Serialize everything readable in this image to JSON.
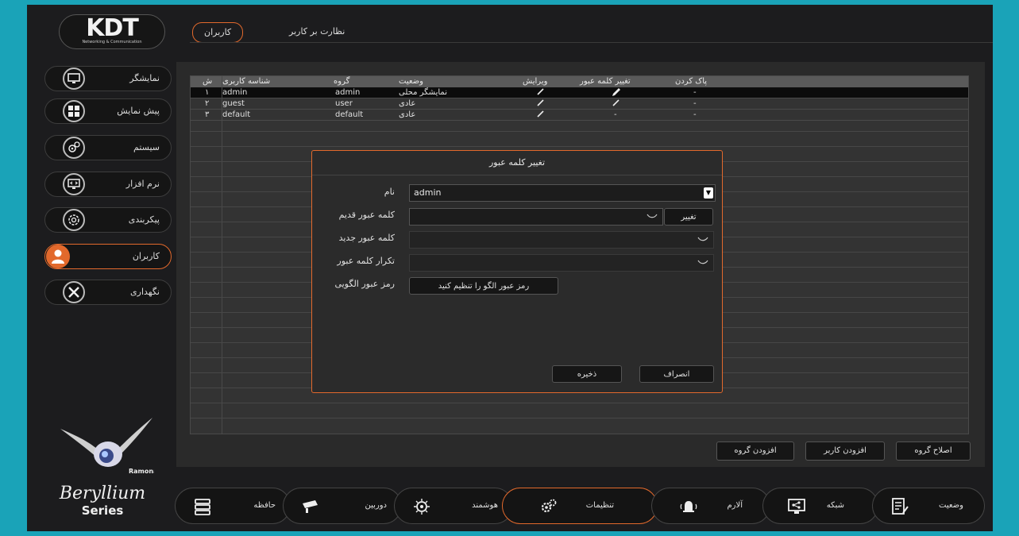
{
  "logo": {
    "text": "KDT",
    "subtitle": "Networking & Communication"
  },
  "top_tabs": [
    {
      "label": "کاربران",
      "active": true
    },
    {
      "label": "نظارت بر کاربر",
      "active": false
    }
  ],
  "sidebar": {
    "items": [
      {
        "label": "نمایشگر",
        "icon": "monitor-icon"
      },
      {
        "label": "پیش نمایش",
        "icon": "grid-icon"
      },
      {
        "label": "سیستم",
        "icon": "gears-icon"
      },
      {
        "label": "نرم افزار",
        "icon": "code-monitor-icon"
      },
      {
        "label": "پیکربندی",
        "icon": "config-gear-icon"
      },
      {
        "label": "کاربران",
        "icon": "user-icon",
        "active": true
      },
      {
        "label": "نگهداری",
        "icon": "tools-icon"
      }
    ]
  },
  "table": {
    "headers": {
      "num": "ش",
      "user_id": "شناسه کاربری",
      "group": "گروه",
      "status": "وضعیت",
      "edit": "ویرایش",
      "change_pw": "تغییر کلمه عبور",
      "clear": "پاک کردن"
    },
    "rows": [
      {
        "num": "۱",
        "user_id": "admin",
        "group": "admin",
        "status": "نمایشگر محلی",
        "clear": "-"
      },
      {
        "num": "۲",
        "user_id": "guest",
        "group": "user",
        "status": "عادی",
        "change_pw": "-",
        "clear": "-"
      },
      {
        "num": "۳",
        "user_id": "default",
        "group": "default",
        "status": "عادی",
        "change_pw": "-",
        "clear": "-"
      }
    ]
  },
  "panel_buttons": {
    "add_group": "افزودن گروه",
    "add_user": "افزودن کاربر",
    "edit_group": "اصلاح گروه"
  },
  "dialog": {
    "title": "تغییر کلمه عبور",
    "name_label": "نام",
    "name_value": "admin",
    "old_pw_label": "کلمه عبور قدیم",
    "change_btn": "تغییر",
    "new_pw_label": "کلمه عبور جدید",
    "repeat_pw_label": "تکرار کلمه عبور",
    "pattern_label": "رمز عبور الگویی",
    "pattern_btn": "رمز عبور الگو را تنظیم کنید",
    "save_btn": "ذخیره",
    "cancel_btn": "انصراف"
  },
  "brand": {
    "line1": "Beryllium",
    "line2": "Series",
    "badge": "Ramona"
  },
  "bottom_nav": [
    {
      "label": "حافظه",
      "icon": "storage-icon"
    },
    {
      "label": "دوربین",
      "icon": "camera-icon"
    },
    {
      "label": "هوشمند",
      "icon": "smart-icon"
    },
    {
      "label": "تنظیمات",
      "icon": "settings-icon",
      "active": true
    },
    {
      "label": "آلارم",
      "icon": "alarm-icon"
    },
    {
      "label": "شبکه",
      "icon": "network-icon"
    },
    {
      "label": "وضعیت",
      "icon": "status-icon"
    }
  ],
  "colors": {
    "accent": "#e2692c",
    "frame": "#1aa3b8",
    "background": "#1c1c1e"
  }
}
